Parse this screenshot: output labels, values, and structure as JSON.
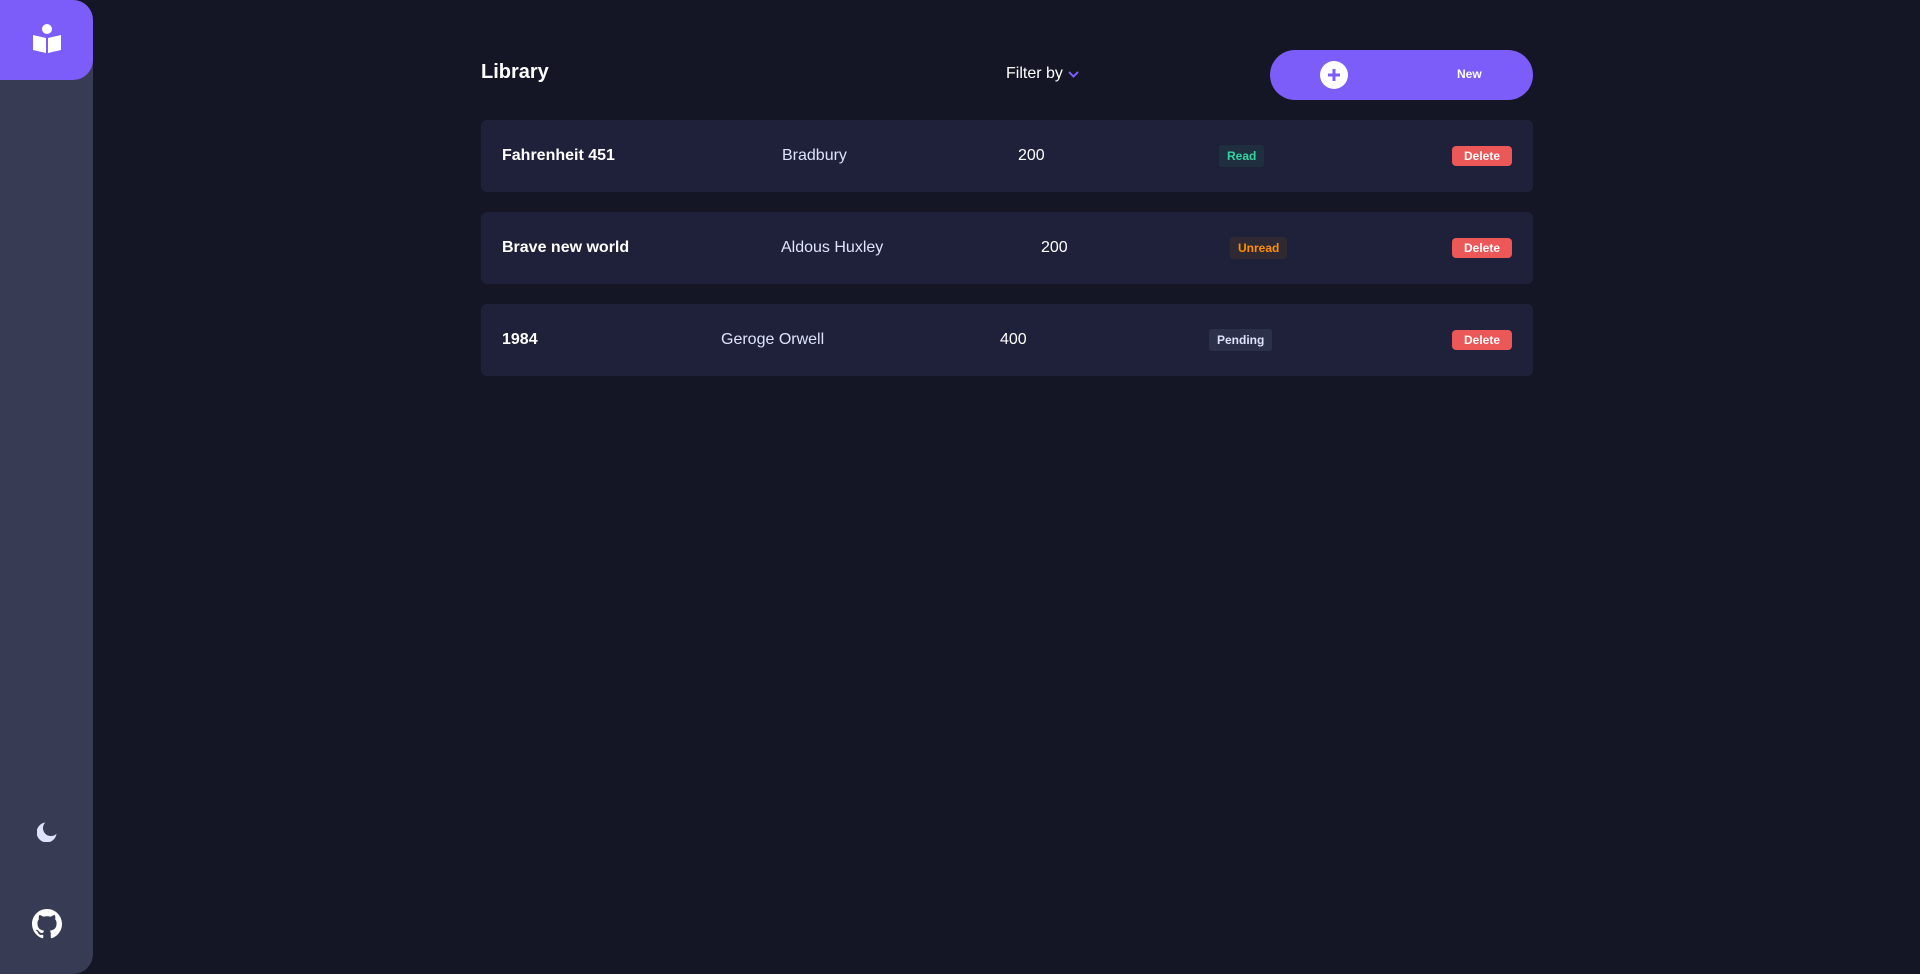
{
  "page": {
    "title": "Library",
    "filter_label": "Filter by",
    "new_button_label": "New"
  },
  "colors": {
    "background": "#141625",
    "sidebar": "#373b53",
    "accent": "#7c5dfa",
    "row_background": "#1e2139",
    "danger": "#ec5757",
    "status_read": "#33d69f",
    "status_unread": "#ff8f00",
    "status_pending": "#dfe3fa"
  },
  "icons": {
    "logo": "book-reader-icon",
    "theme": "moon-icon",
    "github": "github-icon",
    "filter": "chevron-down-icon",
    "new": "plus-icon"
  },
  "books": [
    {
      "title": "Fahrenheit 451",
      "author": "Bradbury",
      "pages": "200",
      "status": "Read",
      "status_key": "read",
      "delete_label": "Delete"
    },
    {
      "title": "Brave new world",
      "author": "Aldous Huxley",
      "pages": "200",
      "status": "Unread",
      "status_key": "unread",
      "delete_label": "Delete"
    },
    {
      "title": "1984",
      "author": "Geroge Orwell",
      "pages": "400",
      "status": "Pending",
      "status_key": "pending",
      "delete_label": "Delete"
    }
  ]
}
